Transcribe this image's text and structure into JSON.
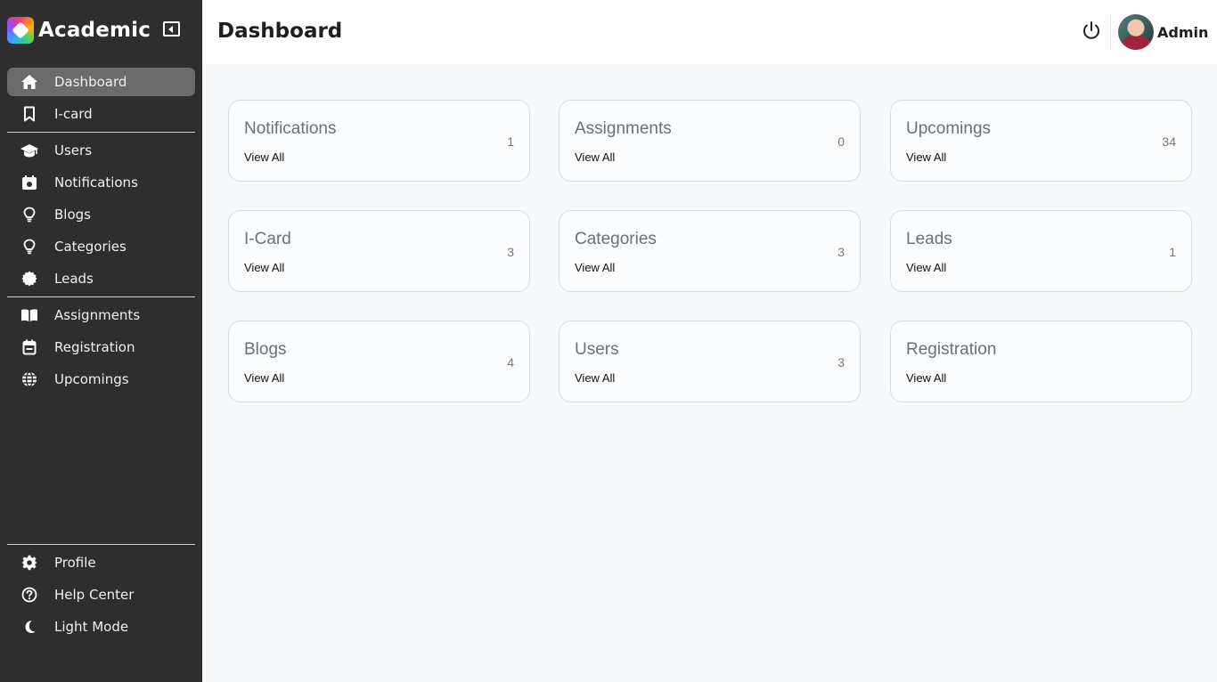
{
  "brand": {
    "name": "Academic"
  },
  "header": {
    "title": "Dashboard",
    "user_name": "Admin"
  },
  "sidebar": {
    "items": [
      {
        "label": "Dashboard",
        "icon": "home-icon",
        "active": true
      },
      {
        "label": "I-card",
        "icon": "bookmark-icon"
      },
      {
        "label": "Users",
        "icon": "graduation-cap-icon"
      },
      {
        "label": "Notifications",
        "icon": "calendar-notification-icon"
      },
      {
        "label": "Blogs",
        "icon": "lightbulb-icon"
      },
      {
        "label": "Categories",
        "icon": "lightbulb-icon"
      },
      {
        "label": "Leads",
        "icon": "certificate-badge-icon"
      },
      {
        "label": "Assignments",
        "icon": "open-book-icon"
      },
      {
        "label": "Registration",
        "icon": "calendar-icon"
      },
      {
        "label": "Upcomings",
        "icon": "globe-icon"
      }
    ],
    "bottom_items": [
      {
        "label": "Profile",
        "icon": "gear-icon"
      },
      {
        "label": "Help Center",
        "icon": "help-circle-icon"
      },
      {
        "label": "Light Mode",
        "icon": "moon-icon"
      }
    ]
  },
  "cards": [
    {
      "title": "Notifications",
      "link": "View All",
      "count": "1"
    },
    {
      "title": "Assignments",
      "link": "View All",
      "count": "0"
    },
    {
      "title": "Upcomings",
      "link": "View All",
      "count": "34"
    },
    {
      "title": "I-Card",
      "link": "View All",
      "count": "3"
    },
    {
      "title": "Categories",
      "link": "View All",
      "count": "3"
    },
    {
      "title": "Leads",
      "link": "View All",
      "count": "1"
    },
    {
      "title": "Blogs",
      "link": "View All",
      "count": "4"
    },
    {
      "title": "Users",
      "link": "View All",
      "count": "3"
    },
    {
      "title": "Registration",
      "link": "View All",
      "count": ""
    }
  ],
  "colors": {
    "sidebar_bg": "#2e2e2e",
    "active_item_bg": "#6b6b6b",
    "page_bg": "#f7f8fa"
  }
}
